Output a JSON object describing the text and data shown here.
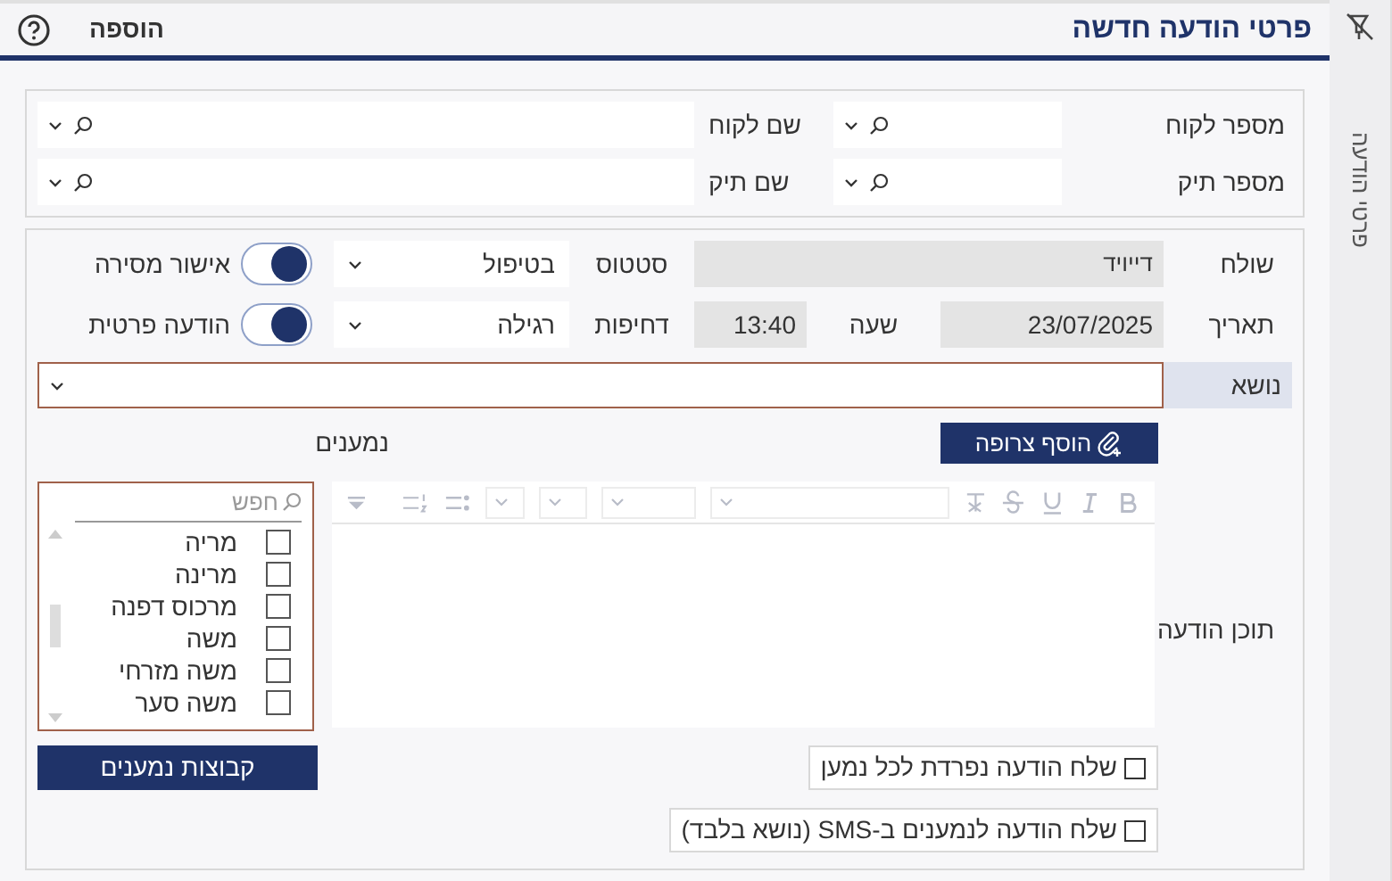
{
  "side_tab": {
    "label": "פרטי הודעה"
  },
  "header": {
    "title": "פרטי הודעה חדשה",
    "action": "הוספה"
  },
  "lookup": [
    {
      "label": "מספר לקוח",
      "kind": "short"
    },
    {
      "label": "שם לקוח",
      "kind": "long"
    },
    {
      "label": "מספר תיק",
      "kind": "short"
    },
    {
      "label": "שם תיק",
      "kind": "long"
    }
  ],
  "form": {
    "sender": {
      "label": "שולח",
      "value": "דייויד"
    },
    "status": {
      "label": "סטטוס",
      "value": "בטיפול"
    },
    "delivery_confirmation": {
      "label": "אישור מסירה",
      "on": true
    },
    "date": {
      "label": "תאריך",
      "value": "23/07/2025"
    },
    "time": {
      "label": "שעה",
      "value": "13:40"
    },
    "priority": {
      "label": "דחיפות",
      "value": "רגילה"
    },
    "private": {
      "label": "הודעה פרטית",
      "on": true
    },
    "subject": {
      "label": "נושא"
    },
    "attach_button": "הוסף צרופה",
    "content_label": "תוכן הודעה",
    "recipients_label": "נמענים",
    "recipients": {
      "placeholder": "חפש",
      "items": [
        {
          "name": "מריה",
          "checked": false
        },
        {
          "name": "מרינה",
          "checked": false
        },
        {
          "name": "מרכוס דפנה",
          "checked": false
        },
        {
          "name": "משה",
          "checked": false
        },
        {
          "name": "משה מזרחי",
          "checked": false
        },
        {
          "name": "משה סער",
          "checked": false
        }
      ]
    },
    "groups_button": "קבוצות נמענים",
    "options": [
      {
        "label": "שלח הודעה נפרדת לכל נמען",
        "checked": false
      },
      {
        "label": "שלח הודעה לנמענים ב-SMS (נושא בלבד)",
        "checked": false
      }
    ]
  }
}
